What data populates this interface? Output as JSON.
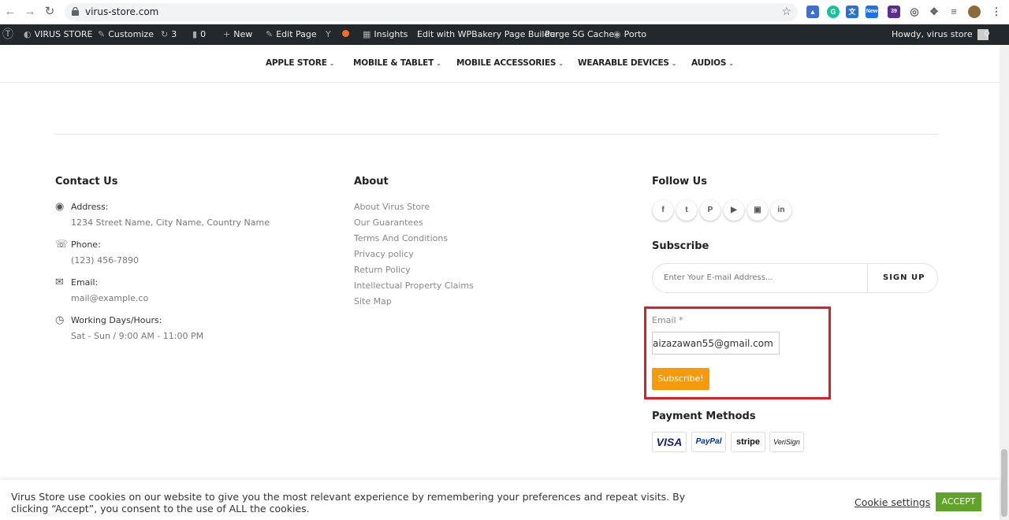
{
  "browser": {
    "url": "virus-store.com",
    "extension_badges": {
      "new": "New",
      "count": "39"
    }
  },
  "admin_bar": {
    "site_name": "VIRUS STORE",
    "customize": "Customize",
    "updates_count": "3",
    "comments_count": "0",
    "new": "New",
    "edit_page": "Edit Page",
    "insights": "Insights",
    "wpbakery": "Edit with WPBakery Page Builder",
    "purge": "Purge SG Cache",
    "porto": "Porto",
    "howdy": "Howdy, virus store"
  },
  "main_nav": [
    "APPLE STORE",
    "MOBILE & TABLET",
    "MOBILE ACCESSORIES",
    "WEARABLE DEVICES",
    "AUDIOS"
  ],
  "contact": {
    "title": "Contact Us",
    "address_label": "Address:",
    "address_value": "1234 Street Name, City Name, Country Name",
    "phone_label": "Phone:",
    "phone_value": "(123) 456-7890",
    "email_label": "Email:",
    "email_value": "mail@example.co",
    "hours_label": "Working Days/Hours:",
    "hours_value": "Sat - Sun / 9:00 AM - 11:00 PM"
  },
  "about": {
    "title": "About",
    "links": [
      "About Virus Store",
      "Our Guarantees",
      "Terms And Conditions",
      "Privacy policy",
      "Return Policy",
      "Intellectual Property Claims",
      "Site Map"
    ]
  },
  "follow": {
    "title": "Follow Us",
    "icons": [
      "facebook-icon",
      "twitter-icon",
      "pinterest-icon",
      "youtube-icon",
      "instagram-icon",
      "linkedin-icon"
    ]
  },
  "subscribe": {
    "title": "Subscribe",
    "placeholder": "Enter Your E-mail Address...",
    "signup": "SIGN UP",
    "email_label": "Email *",
    "email_value": "aizazawan55@gmail.com",
    "button": "Subscribe!"
  },
  "payment": {
    "title": "Payment Methods",
    "cards": [
      "VISA",
      "PayPal",
      "stripe",
      "VeriSign"
    ]
  },
  "cookie": {
    "text": "Virus Store use cookies on our website to give you the most relevant experience by remembering your preferences and repeat visits. By clicking “Accept”, you consent to the use of ALL the cookies.",
    "settings": "Cookie settings",
    "accept": "ACCEPT"
  },
  "colors": {
    "accent_orange": "#f79a07",
    "highlight_red": "#e01c24",
    "accept_green": "#61a229",
    "admin_bar": "#23282d"
  }
}
